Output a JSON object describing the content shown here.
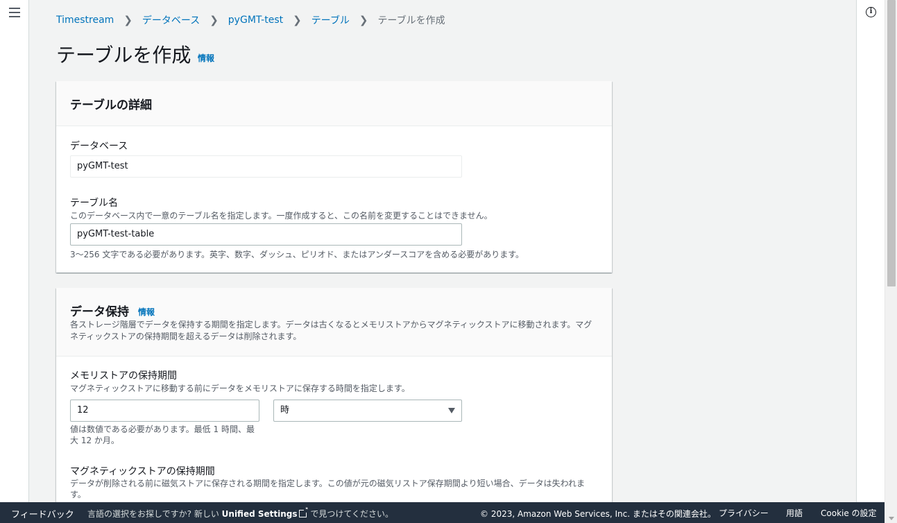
{
  "header": {
    "menu_icon": "hamburger-menu-icon",
    "info_icon": "info-circle-icon"
  },
  "breadcrumb": [
    {
      "label": "Timestream"
    },
    {
      "label": "データベース"
    },
    {
      "label": "pyGMT-test"
    },
    {
      "label": "テーブル"
    },
    {
      "label": "テーブルを作成"
    }
  ],
  "page": {
    "title": "テーブルを作成",
    "info_link": "情報"
  },
  "table_details": {
    "title": "テーブルの詳細",
    "database_label": "データベース",
    "database_value": "pyGMT-test",
    "table_name_label": "テーブル名",
    "table_name_desc": "このデータベース内で一意のテーブル名を指定します。一度作成すると、この名前を変更することはできません。",
    "table_name_value": "pyGMT-test-table",
    "table_name_constraint": "3〜256 文字である必要があります。英字、数字、ダッシュ、ピリオド、またはアンダースコアを含める必要があります。"
  },
  "data_retention": {
    "title": "データ保持",
    "info_link": "情報",
    "desc_line1": "各ストレージ階層でデータを保持する期間を指定します。データは古くなるとメモリストアからマグネティックストアに移動されます。マグ",
    "desc_line2": "ネティックストアの保持期間を超えるデータは削除されます。",
    "memory_label": "メモリストアの保持期間",
    "memory_desc": "マグネティックストアに移動する前にデータをメモリストアに保存する時間を指定します。",
    "memory_value": "12",
    "memory_unit": "時",
    "memory_constraint_line1": "値は数値である必要があります。最低 1 時間、最",
    "memory_constraint_line2": "大 12 か月。",
    "magnetic_label": "マグネティックストアの保持期間",
    "magnetic_desc_line1": "データが削除される前に磁気ストアに保存される期間を指定します。この値が元の磁気リストア保存期間より短い場合、データは失われま",
    "magnetic_desc_line2": "す。"
  },
  "footer": {
    "feedback": "フィードバック",
    "lang_prefix": "言語の選択をお探しですか? 新しい",
    "lang_strong": "Unified Settings",
    "lang_suffix": "で見つけてください。",
    "copyright": "© 2023, Amazon Web Services, Inc. またはその関連会社。",
    "privacy": "プライバシー",
    "terms": "用語",
    "cookie": "Cookie の設定"
  },
  "colors": {
    "link": "#0073bb",
    "footer_bg": "#232f3e",
    "page_bg": "#f2f3f3"
  }
}
